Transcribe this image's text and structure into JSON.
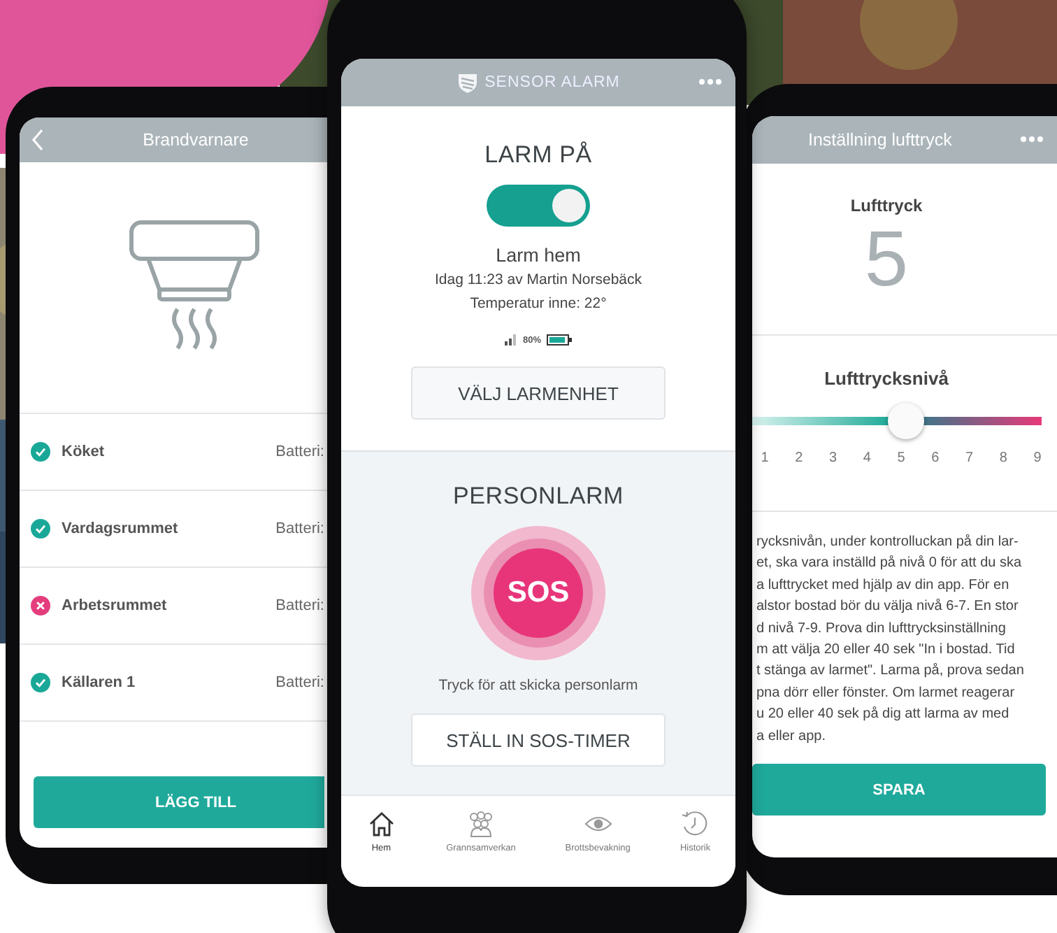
{
  "left_screen": {
    "title": "Brandvarnare",
    "detectors": [
      {
        "name": "Köket",
        "ok": true,
        "battery_label": "Batteri:"
      },
      {
        "name": "Vardagsrummet",
        "ok": true,
        "battery_label": "Batteri:"
      },
      {
        "name": "Arbetsrummet",
        "ok": false,
        "battery_label": "Batteri:"
      },
      {
        "name": "Källaren 1",
        "ok": true,
        "battery_label": "Batteri:"
      }
    ],
    "button": "LÄGG TILL"
  },
  "center_screen": {
    "brand": "SENSOR ALARM",
    "alarm": {
      "title": "LARM PÅ",
      "on": true,
      "mode": "Larm hem",
      "last_change": "Idag 11:23 av Martin Norsebäck",
      "temperature": "Temperatur inne: 22°",
      "battery_percent": "80%",
      "button": "VÄLJ LARMENHET"
    },
    "personal_alarm": {
      "title": "PERSONLARM",
      "sos": "SOS",
      "hint": "Tryck för att skicka personlarm",
      "button": "STÄLL IN SOS-TIMER"
    },
    "nav": [
      {
        "label": "Hem",
        "selected": true
      },
      {
        "label": "Grannsamverkan",
        "selected": false
      },
      {
        "label": "Brottsbevakning",
        "selected": false
      },
      {
        "label": "Historik",
        "selected": false
      }
    ]
  },
  "right_screen": {
    "title": "Inställning lufttryck",
    "pressure_label": "Lufttryck",
    "pressure_value": "5",
    "level_label": "Lufttrycksnivå",
    "slider": {
      "level": 0.53
    },
    "scale": [
      "1",
      "2",
      "3",
      "4",
      "5",
      "6",
      "7",
      "8",
      "9"
    ],
    "description_lines": [
      "rycksnivån, under kontrolluckan på din lar-",
      "et, ska vara inställd på nivå 0 för att du ska",
      "a lufttrycket med hjälp av din app. För en",
      "alstor bostad bör du välja nivå 6-7. En stor",
      "d nivå 7-9. Prova din lufttrycksinställning",
      "m att välja 20 eller 40 sek \"In i bostad. Tid",
      "t stänga av larmet\". Larma på, prova sedan",
      "pna dörr eller fönster. Om larmet reagerar",
      "u 20 eller 40 sek på dig att larma av med",
      "a eller app."
    ],
    "button": "SPARA"
  }
}
